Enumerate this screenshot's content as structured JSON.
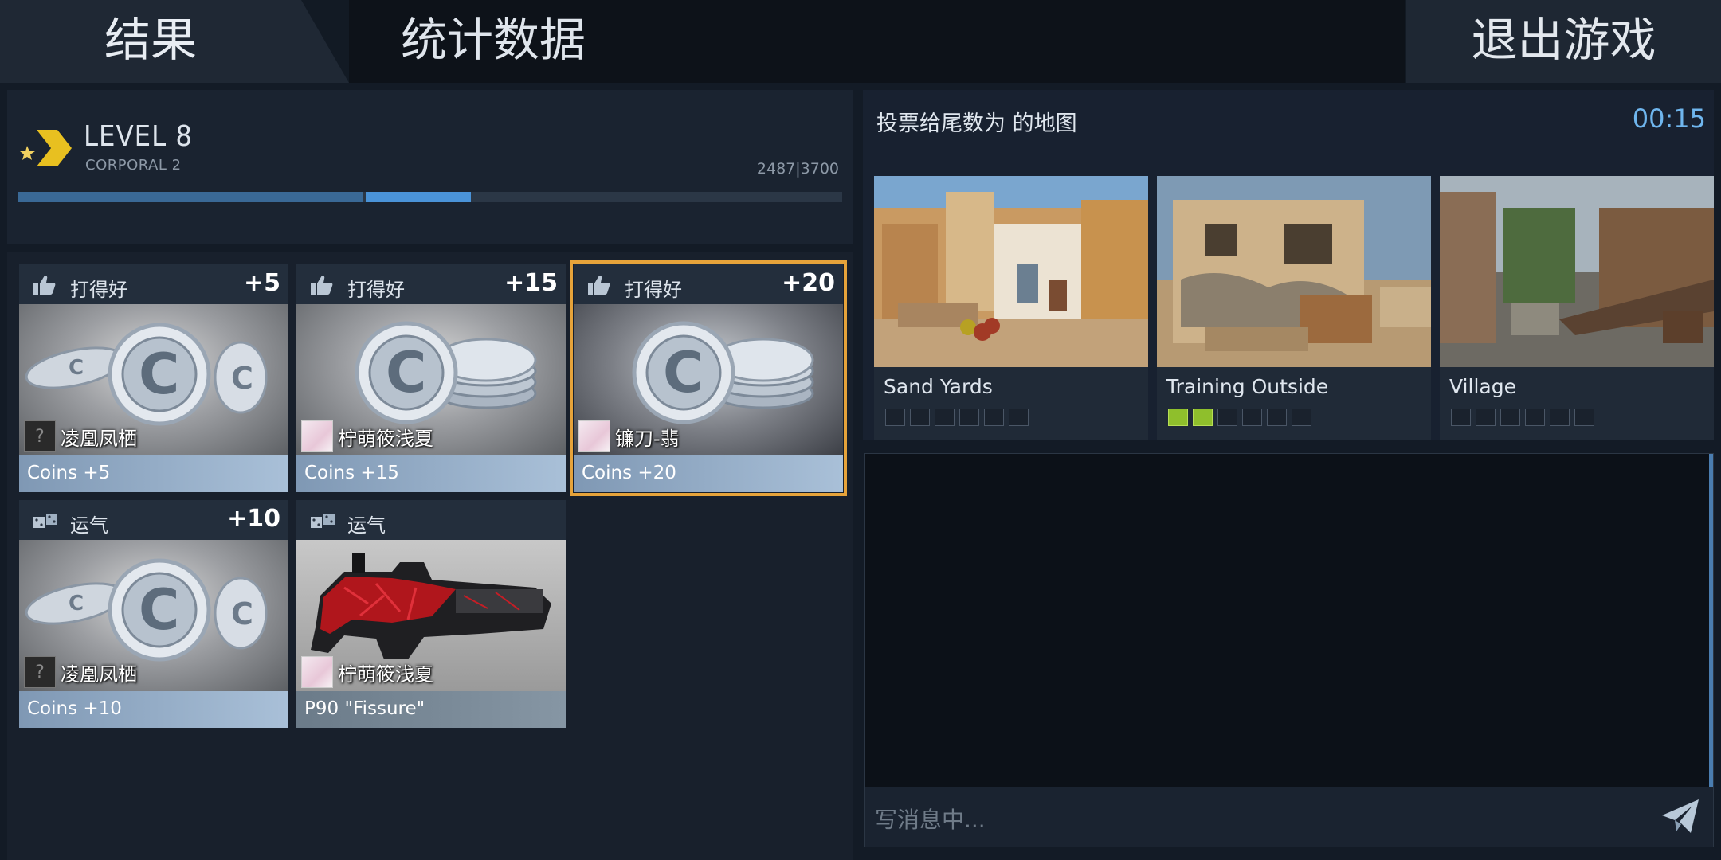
{
  "tabs": {
    "result": "结果",
    "stats": "统计数据"
  },
  "exit_button": "退出游戏",
  "level": {
    "title": "LEVEL 8",
    "rank": "CORPORAL 2",
    "xp_text": "2487|3700",
    "xp_fraction": 0.546,
    "gain_fraction": 0.128
  },
  "rewards": [
    {
      "category": "打得好",
      "icon": "thumbs-up-icon",
      "amount": "+5",
      "player": "凌凰凤栖",
      "avatar": "unknown",
      "item": "Coins +5",
      "image": "coins"
    },
    {
      "category": "打得好",
      "icon": "thumbs-up-icon",
      "amount": "+15",
      "player": "柠萌筱浅夏",
      "avatar": "anime",
      "item": "Coins +15",
      "image": "coins-stack"
    },
    {
      "category": "打得好",
      "icon": "thumbs-up-icon",
      "amount": "+20",
      "player": "镰刀-翡",
      "avatar": "anime",
      "item": "Coins +20",
      "image": "coins-stack",
      "selected": true
    },
    {
      "category": "运气",
      "icon": "dice-icon",
      "amount": "+10",
      "player": "凌凰凤栖",
      "avatar": "unknown",
      "item": "Coins +10",
      "image": "coins"
    },
    {
      "category": "运气",
      "icon": "dice-icon",
      "amount": "",
      "player": "柠萌筱浅夏",
      "avatar": "anime",
      "item": "P90 \"Fissure\"",
      "image": "gun"
    }
  ],
  "vote": {
    "title": "投票给尾数为 的地图",
    "timer": "00:15",
    "maps": [
      {
        "name": "Sand Yards",
        "votes": 0,
        "slots": 6
      },
      {
        "name": "Training Outside",
        "votes": 2,
        "slots": 6
      },
      {
        "name": "Village",
        "votes": 0,
        "slots": 6
      }
    ]
  },
  "chat": {
    "placeholder": "写消息中..."
  },
  "colors": {
    "accent_blue": "#6fb6ee",
    "selected_outline": "#e6a33a",
    "vote_on": "#8fbf2c"
  }
}
